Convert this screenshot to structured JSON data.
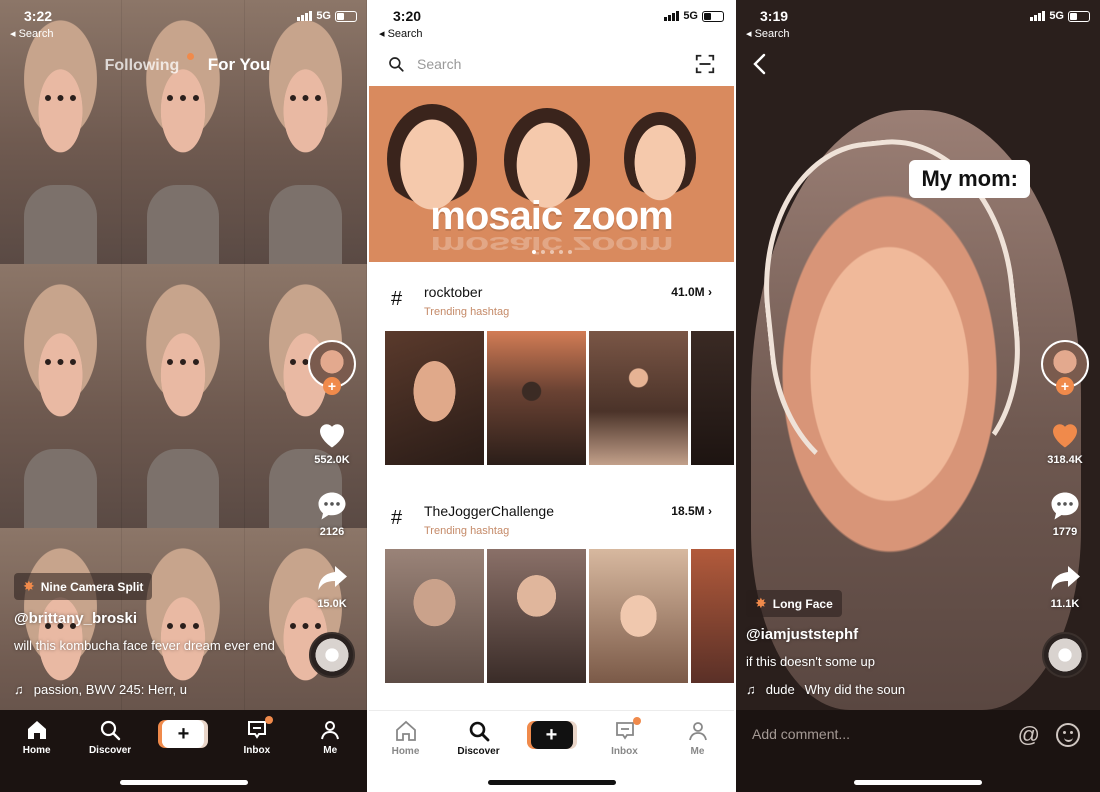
{
  "panel1": {
    "status": {
      "time": "3:22",
      "back": "◂ Search",
      "network": "5G"
    },
    "nav": {
      "following": "Following",
      "for_you": "For You"
    },
    "rail": {
      "likes": "552.0K",
      "comments": "2126",
      "shares": "15.0K"
    },
    "effect": "Nine Camera Split",
    "username": "@brittany_broski",
    "caption": "will this kombucha face fever dream ever end",
    "music": "passion, BWV 245: Herr, u",
    "tabs": {
      "home": "Home",
      "discover": "Discover",
      "inbox": "Inbox",
      "me": "Me",
      "plus": "+"
    }
  },
  "panel2": {
    "status": {
      "time": "3:20",
      "back": "◂ Search",
      "network": "5G"
    },
    "search_placeholder": "Search",
    "banner_title": "mosaic zoom",
    "hashtags": [
      {
        "name": "rocktober",
        "sub": "Trending hashtag",
        "count": "41.0M",
        "symbol": "#"
      },
      {
        "name": "TheJoggerChallenge",
        "sub": "Trending hashtag",
        "count": "18.5M",
        "symbol": "#"
      }
    ],
    "tabs": {
      "home": "Home",
      "discover": "Discover",
      "inbox": "Inbox",
      "me": "Me",
      "plus": "+"
    }
  },
  "panel3": {
    "status": {
      "time": "3:19",
      "back": "◂ Search",
      "network": "5G"
    },
    "sticker": "My mom:",
    "rail": {
      "likes": "318.4K",
      "comments": "1779",
      "shares": "11.1K"
    },
    "effect": "Long Face",
    "username": "@iamjuststephf",
    "caption": "if this doesn't some up",
    "music_a": "dude",
    "music_b": "Why did the soun",
    "comment_placeholder": "Add comment...",
    "at_symbol": "@"
  },
  "colors": {
    "accent": "#f08a4b",
    "dark_bar": "#1b1311"
  }
}
